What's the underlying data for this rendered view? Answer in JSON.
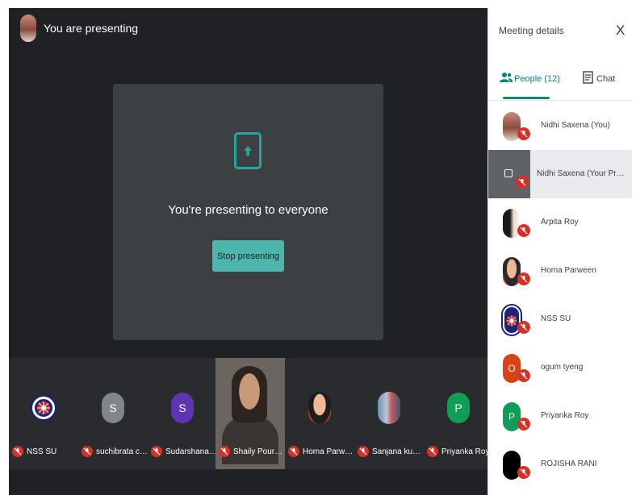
{
  "header": {
    "title": "You are presenting"
  },
  "present_card": {
    "message": "You're presenting to everyone",
    "stop_label": "Stop presenting"
  },
  "filmstrip": {
    "tiles": [
      {
        "name": "NSS SU",
        "avatar_type": "logo",
        "color": "#1a237e"
      },
      {
        "name": "suchibrata cha...",
        "avatar_type": "initial",
        "initial": "S",
        "color": "#80868b"
      },
      {
        "name": "Sudarshana Bh...",
        "avatar_type": "initial",
        "initial": "S",
        "color": "#5e35b1"
      },
      {
        "name": "Shaily Pourush",
        "avatar_type": "video"
      },
      {
        "name": "Homa Parween",
        "avatar_type": "photo"
      },
      {
        "name": "Sanjana kumari",
        "avatar_type": "photo"
      },
      {
        "name": "Priyanka Roy",
        "avatar_type": "initial",
        "initial": "P",
        "color": "#0f9d58"
      }
    ]
  },
  "panel": {
    "title": "Meeting details",
    "close_label": "X",
    "tabs": {
      "people": "People (12)",
      "chat": "Chat"
    },
    "participants": [
      {
        "name": "Nidhi Saxena (You)",
        "avatar_type": "photo"
      },
      {
        "name": "Nidhi Saxena (Your Presentatio...",
        "avatar_type": "presentation"
      },
      {
        "name": "Arpita Roy",
        "avatar_type": "photo"
      },
      {
        "name": "Homa Parween",
        "avatar_type": "photo"
      },
      {
        "name": "NSS SU",
        "avatar_type": "logo",
        "color": "#1a237e"
      },
      {
        "name": "ogum tyeng",
        "avatar_type": "initial",
        "initial": "O",
        "color": "#d84315"
      },
      {
        "name": "Priyanka Roy",
        "avatar_type": "initial",
        "initial": "P",
        "color": "#0f9d58"
      },
      {
        "name": "ROJISHA RANI",
        "avatar_type": "initial",
        "initial": "",
        "color": "#000000"
      }
    ]
  },
  "colors": {
    "accent": "#00897b",
    "button": "#4db6ac",
    "muted_mic": "#d93025",
    "stage": "#202124"
  }
}
